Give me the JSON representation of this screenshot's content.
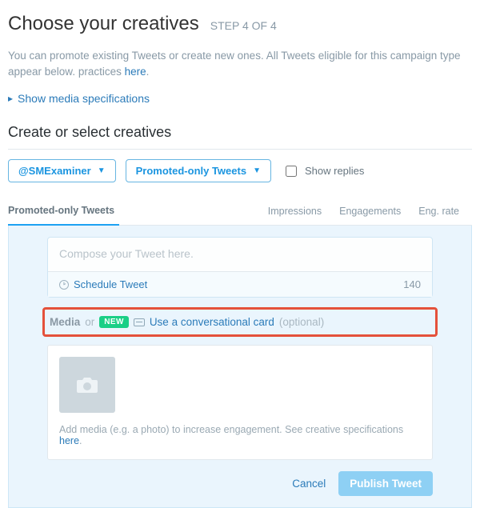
{
  "header": {
    "title": "Choose your creatives",
    "step_label": "STEP 4 OF 4"
  },
  "intro": {
    "text_before": "You can promote existing Tweets or create new ones. All Tweets eligible for this campaign type appear below. practices ",
    "link": "here",
    "text_after": "."
  },
  "spec_link": "Show media specifications",
  "section_title": "Create or select creatives",
  "filters": {
    "account_label": "@SMExaminer",
    "scope_label": "Promoted-only Tweets",
    "show_replies_label": "Show replies",
    "show_replies_checked": false
  },
  "table_headers": {
    "main": "Promoted-only Tweets",
    "impressions": "Impressions",
    "engagements": "Engagements",
    "eng_rate": "Eng. rate"
  },
  "composer": {
    "placeholder": "Compose your Tweet here.",
    "schedule_label": "Schedule Tweet",
    "char_count": "140"
  },
  "media_row": {
    "media_label": "Media",
    "or": "or",
    "new_badge": "NEW",
    "conv_link": "Use a conversational card",
    "optional": "(optional)"
  },
  "media_card": {
    "help_before": "Add media (e.g. a photo) to increase engagement. See creative specifications ",
    "help_link": "here",
    "help_after": "."
  },
  "actions": {
    "cancel": "Cancel",
    "publish": "Publish Tweet"
  }
}
